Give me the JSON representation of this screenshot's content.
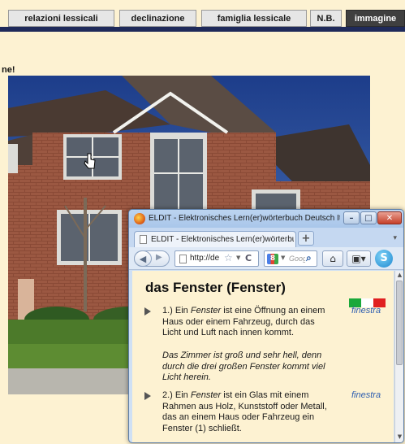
{
  "site": {
    "tabs": [
      {
        "label": "relazioni lessicali"
      },
      {
        "label": "declinazione"
      },
      {
        "label": "famiglia lessicale"
      },
      {
        "label": "N.B."
      },
      {
        "label": "immagine"
      }
    ],
    "heading_fragment": "ne!"
  },
  "browser": {
    "window_title": "ELDIT - Elektronisches Lern(er)wörterbuch Deutsch Ital...",
    "tab_title": "ELDIT - Elektronisches Lern(er)wörterbuc...",
    "new_tab_label": "+",
    "url": "http://de",
    "search_placeholder": "Goog",
    "window_controls": {
      "minimize": "–",
      "maximize": "□",
      "close": "✕"
    }
  },
  "entry": {
    "title": "das Fenster (Fenster)",
    "flag_colors": [
      "#1aa83a",
      "#ffffff",
      "#e02020"
    ],
    "senses": [
      {
        "number": "1.)",
        "before": "Ein",
        "term": "Fenster",
        "after": "ist eine Öffnung an einem Haus oder einem Fahrzeug, durch das Licht und Luft nach innen kommt.",
        "translation": "finestra",
        "example": "Das Zimmer ist groß und sehr hell, denn durch die drei großen Fenster kommt viel Licht herein."
      },
      {
        "number": "2.)",
        "before": "Ein",
        "term": "Fenster",
        "after": "ist ein Glas mit einem Rahmen aus Holz, Kunststoff oder Metall, das an einem Haus oder Fahrzeug ein Fenster (1) schließt.",
        "translation": "finestra"
      }
    ]
  },
  "colors": {
    "page_background": "#fdf2d2",
    "tab_active": "#3f3f3f",
    "nav_line": "#1f2a5a",
    "translation_link": "#2f5fb0"
  }
}
